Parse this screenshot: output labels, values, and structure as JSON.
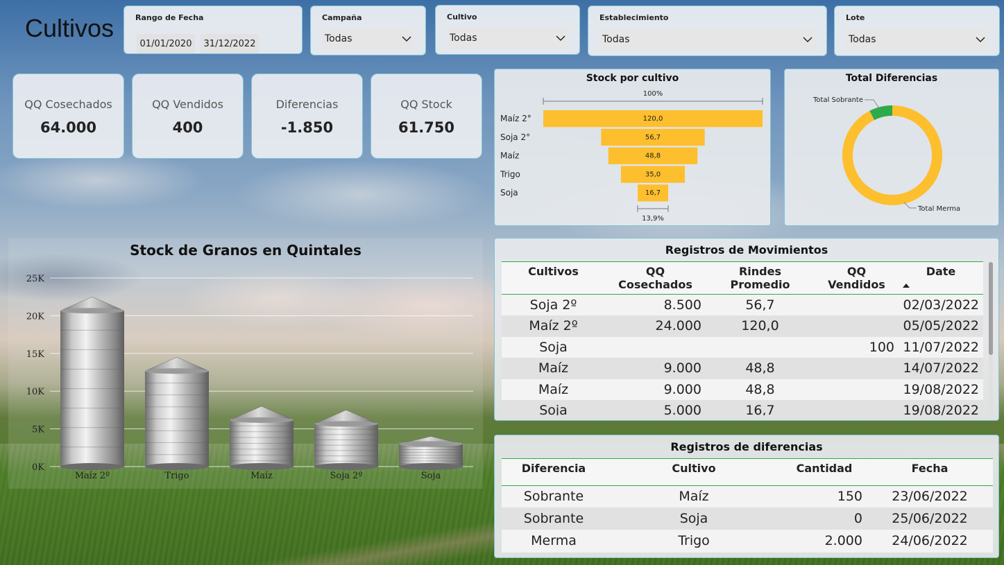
{
  "page_title": "Cultivos",
  "filters": {
    "date_range": {
      "label": "Rango de Fecha",
      "start": "01/01/2020",
      "end": "31/12/2022"
    },
    "campana": {
      "label": "Campaña",
      "value": "Todas"
    },
    "cultivo": {
      "label": "Cultivo",
      "value": "Todas"
    },
    "establecimiento": {
      "label": "Establecimiento",
      "value": "Todas"
    },
    "lote": {
      "label": "Lote",
      "value": "Todas"
    }
  },
  "kpis": [
    {
      "label": "QQ Cosechados",
      "value": "64.000"
    },
    {
      "label": "QQ Vendidos",
      "value": "400"
    },
    {
      "label": "Diferencias",
      "value": "-1.850"
    },
    {
      "label": "QQ Stock",
      "value": "61.750"
    }
  ],
  "funnel": {
    "title": "Stock por cultivo",
    "top_pct": "100%",
    "bottom_pct": "13,9%",
    "rows": [
      {
        "label": "Maíz 2°",
        "value": 120.0,
        "text": "120,0"
      },
      {
        "label": "Soja 2°",
        "value": 56.7,
        "text": "56,7"
      },
      {
        "label": "Maíz",
        "value": 48.8,
        "text": "48,8"
      },
      {
        "label": "Trigo",
        "value": 35.0,
        "text": "35,0"
      },
      {
        "label": "Soja",
        "value": 16.7,
        "text": "16,7"
      }
    ],
    "color": "#FDBF2D"
  },
  "donut": {
    "title": "Total Diferencias",
    "labels": {
      "sobrante": "Total Sobrante",
      "merma": "Total Merma"
    },
    "sobrante_fraction": 0.075,
    "colors": {
      "sobrante": "#2EAA4A",
      "merma": "#FDBF2D"
    }
  },
  "chart_data": {
    "type": "bar",
    "title": "Stock de Granos en Quintales",
    "categories": [
      "Maíz 2º",
      "Trigo",
      "Maíz",
      "Soja 2º",
      "Soja"
    ],
    "values": [
      22500,
      14500,
      8000,
      7500,
      4000
    ],
    "ylim": [
      0,
      25000
    ],
    "yticks": [
      0,
      5000,
      10000,
      15000,
      20000,
      25000
    ],
    "yticklabels": [
      "0K",
      "5K",
      "10K",
      "15K",
      "20K",
      "25K"
    ],
    "xlabel": "",
    "ylabel": "",
    "grid": true
  },
  "movimientos": {
    "title": "Registros de Movimientos",
    "columns": [
      "Cultivos",
      "QQ Cosechados",
      "Rindes Promedio",
      "QQ Vendidos",
      "Date"
    ],
    "rows": [
      [
        "Soja 2º",
        "8.500",
        "56,7",
        "",
        "02/03/2022"
      ],
      [
        "Maíz 2º",
        "24.000",
        "120,0",
        "",
        "05/05/2022"
      ],
      [
        "Soja",
        "",
        "",
        "100",
        "11/07/2022"
      ],
      [
        "Maíz",
        "9.000",
        "48,8",
        "",
        "14/07/2022"
      ],
      [
        "Maíz",
        "9.000",
        "48,8",
        "",
        "19/08/2022"
      ],
      [
        "Soja",
        "5.000",
        "16,7",
        "",
        "19/08/2022"
      ]
    ]
  },
  "diferencias": {
    "title": "Registros de diferencias",
    "columns": [
      "Diferencia",
      "Cultivo",
      "Cantidad",
      "Fecha"
    ],
    "rows": [
      [
        "Sobrante",
        "Maíz",
        "150",
        "23/06/2022"
      ],
      [
        "Sobrante",
        "Soja",
        "0",
        "25/06/2022"
      ],
      [
        "Merma",
        "Trigo",
        "2.000",
        "24/06/2022"
      ]
    ]
  }
}
